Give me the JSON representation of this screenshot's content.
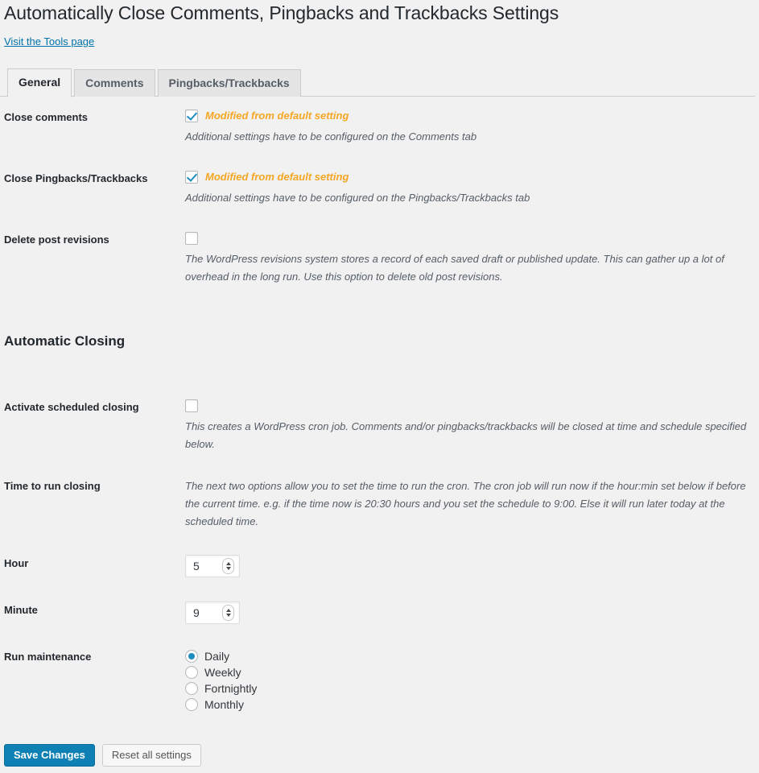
{
  "page": {
    "title": "Automatically Close Comments, Pingbacks and Trackbacks Settings",
    "tools_link": "Visit the Tools page",
    "accent_blue": "#0073aa",
    "modified_orange": "#f5a623",
    "background": "#f1f1f1"
  },
  "tabs": [
    {
      "label": "General",
      "active": true
    },
    {
      "label": "Comments",
      "active": false
    },
    {
      "label": "Pingbacks/Trackbacks",
      "active": false
    }
  ],
  "general": {
    "close_comments": {
      "label": "Close comments",
      "checked": true,
      "modified_note": "Modified from default setting",
      "description": "Additional settings have to be configured on the Comments tab"
    },
    "close_pingbacks": {
      "label": "Close Pingbacks/Trackbacks",
      "checked": true,
      "modified_note": "Modified from default setting",
      "description": "Additional settings have to be configured on the Pingbacks/Trackbacks tab"
    },
    "delete_revisions": {
      "label": "Delete post revisions",
      "checked": false,
      "description": "The WordPress revisions system stores a record of each saved draft or published update. This can gather up a lot of overhead in the long run. Use this option to delete old post revisions."
    }
  },
  "automatic_closing": {
    "heading": "Automatic Closing",
    "activate_scheduled": {
      "label": "Activate scheduled closing",
      "checked": false,
      "description": "This creates a WordPress cron job. Comments and/or pingbacks/trackbacks will be closed at time and schedule specified below."
    },
    "time_to_run": {
      "label": "Time to run closing",
      "description": "The next two options allow you to set the time to run the cron. The cron job will run now if the hour:min set below if before the current time. e.g. if the time now is 20:30 hours and you set the schedule to 9:00. Else it will run later today at the scheduled time."
    },
    "hour": {
      "label": "Hour",
      "value": "5"
    },
    "minute": {
      "label": "Minute",
      "value": "9"
    },
    "run_maintenance": {
      "label": "Run maintenance",
      "selected": "Daily",
      "options": [
        {
          "label": "Daily",
          "selected": true
        },
        {
          "label": "Weekly",
          "selected": false
        },
        {
          "label": "Fortnightly",
          "selected": false
        },
        {
          "label": "Monthly",
          "selected": false
        }
      ]
    }
  },
  "actions": {
    "save_label": "Save Changes",
    "reset_label": "Reset all settings"
  }
}
